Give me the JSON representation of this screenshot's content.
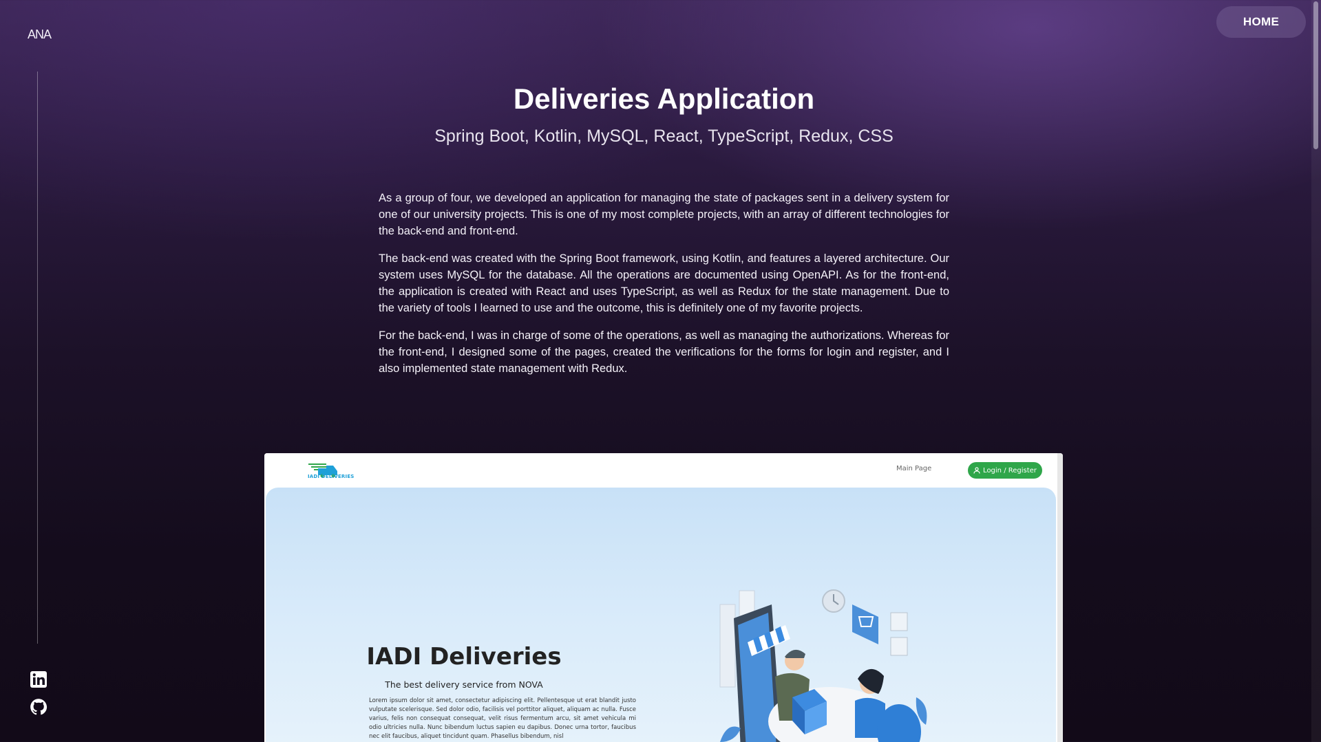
{
  "brand": {
    "logo_text": "ANA"
  },
  "nav": {
    "home_label": "HOME"
  },
  "project": {
    "title": "Deliveries Application",
    "tech_stack": "Spring Boot, Kotlin, MySQL, React, TypeScript, Redux, CSS",
    "paragraphs": [
      "As a group of four, we developed an application for managing the state of packages sent in a delivery system for one of our university projects. This is one of my most complete projects, with an array of different technologies for the back-end and front-end.",
      "The back-end was created with the Spring Boot framework, using Kotlin, and features a layered architecture. Our system uses MySQL for the database. All the operations are documented using OpenAPI. As for the front-end, the application is created with React and uses TypeScript, as well as Redux for the state management. Due to the variety of tools I learned to use and the outcome, this is definitely one of my favorite projects.",
      "For the back-end, I was in charge of some of the operations, as well as managing the authorizations. Whereas for the front-end, I designed some of the pages, created the verifications for the forms for login and register, and I also implemented state management with Redux."
    ]
  },
  "social": {
    "icons": [
      "linkedin-icon",
      "github-icon"
    ]
  },
  "screenshot": {
    "logo_text": "IADI DELIVERIES",
    "nav_main_page": "Main Page",
    "login_label": "Login / Register",
    "hero_title": "IADI Deliveries",
    "hero_tagline": "The best delivery service from NOVA",
    "hero_text": "Lorem ipsum dolor sit amet, consectetur adipiscing elit. Pellentesque ut erat blandit justo vulputate scelerisque. Sed dolor odio, facilisis vel porttitor aliquet, aliquam ac nulla. Fusce varius, felis non consequat consequat, velit risus fermentum arcu, sit amet vehicula mi odio ultricies nulla. Nunc bibendum luctus sapien eu dapibus. Donec urna tortor, faucibus nec elit faucibus, aliquet tincidunt quam. Phasellus bibendum, nisl",
    "colors": {
      "login_green": "#2fa64a",
      "hero_bg": "#c8e1f7",
      "logo_blue": "#1ea0d8"
    }
  }
}
